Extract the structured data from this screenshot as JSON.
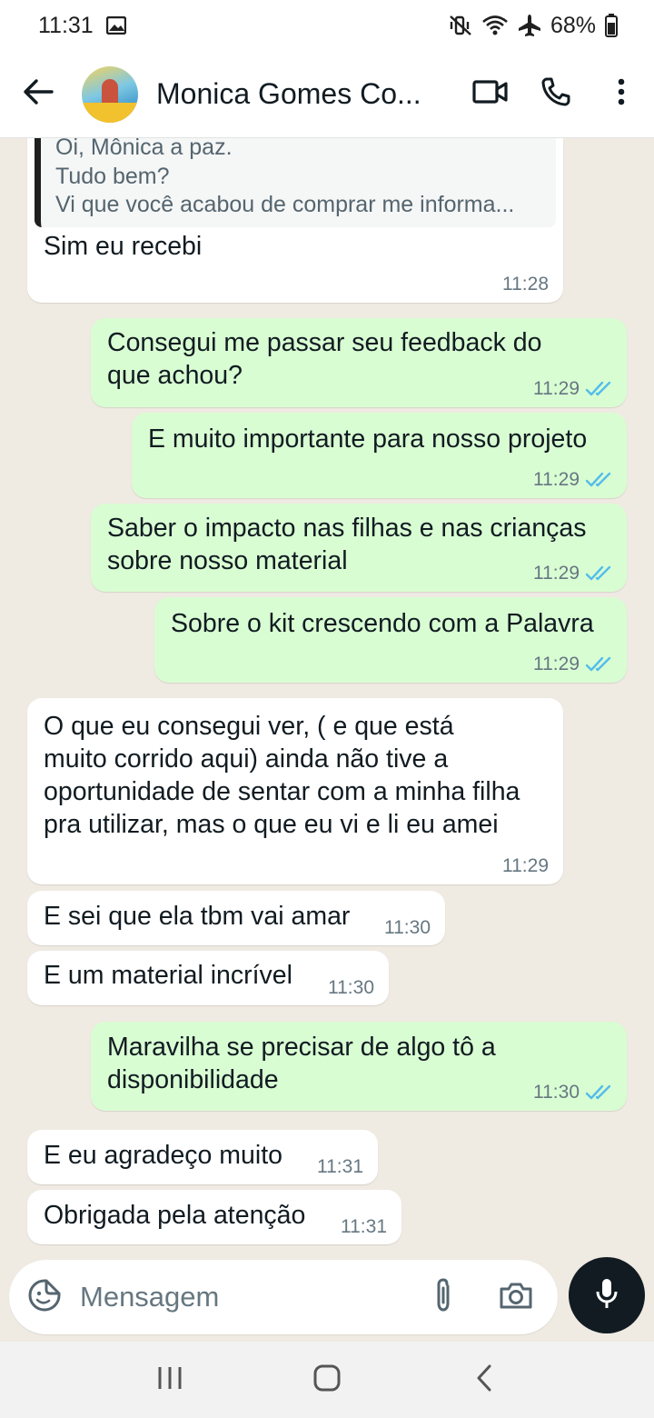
{
  "status_bar": {
    "time": "11:31",
    "battery": "68%",
    "icons": [
      "gallery-icon",
      "mute-vibrate-icon",
      "wifi-icon",
      "airplane-icon",
      "battery-icon"
    ]
  },
  "header": {
    "title": "Monica Gomes Co...",
    "icons": [
      "back-arrow-icon",
      "video-call-icon",
      "voice-call-icon",
      "more-vert-icon"
    ]
  },
  "messages": [
    {
      "dir": "in",
      "quote_lines": [
        "Oi, Mônica a paz.",
        "Tudo bem?",
        "Vi que você acabou de comprar me informa..."
      ],
      "text": [
        "Sim eu recebi"
      ],
      "time": "11:28"
    },
    {
      "dir": "out",
      "text": [
        "Consegui me passar seu feedback do",
        "que achou?"
      ],
      "time": "11:29",
      "read": true
    },
    {
      "dir": "out",
      "text": [
        "E muito importante para nosso projeto"
      ],
      "time": "11:29",
      "read": true
    },
    {
      "dir": "out",
      "text": [
        "Saber o impacto nas filhas e nas crianças",
        "sobre nosso material"
      ],
      "time": "11:29",
      "read": true
    },
    {
      "dir": "out",
      "text": [
        "Sobre o kit crescendo com a Palavra"
      ],
      "time": "11:29",
      "read": true
    },
    {
      "dir": "in",
      "text": [
        "O que eu consegui ver, ( e que está",
        "muito corrido aqui) ainda não tive a",
        "oportunidade de sentar com a minha filha",
        "pra utilizar, mas o que eu vi e li eu amei"
      ],
      "time": "11:29"
    },
    {
      "dir": "in",
      "text": [
        "E sei que ela tbm vai amar"
      ],
      "time": "11:30"
    },
    {
      "dir": "in",
      "text": [
        "E um material incrível"
      ],
      "time": "11:30"
    },
    {
      "dir": "out",
      "text": [
        "Maravilha se precisar de algo tô a",
        "disponibilidade"
      ],
      "time": "11:30",
      "read": true
    },
    {
      "dir": "in",
      "text": [
        "E eu agradeço muito"
      ],
      "time": "11:31"
    },
    {
      "dir": "in",
      "text": [
        "Obrigada pela atenção"
      ],
      "time": "11:31"
    }
  ],
  "composer": {
    "placeholder": "Mensagem",
    "icons": [
      "sticker-emoji-icon",
      "attach-icon",
      "camera-icon",
      "mic-icon"
    ]
  },
  "colors": {
    "chat_background": "#efeae2",
    "incoming_bubble": "#ffffff",
    "outgoing_bubble": "#d9fdd3",
    "read_tick": "#53bdeb"
  }
}
